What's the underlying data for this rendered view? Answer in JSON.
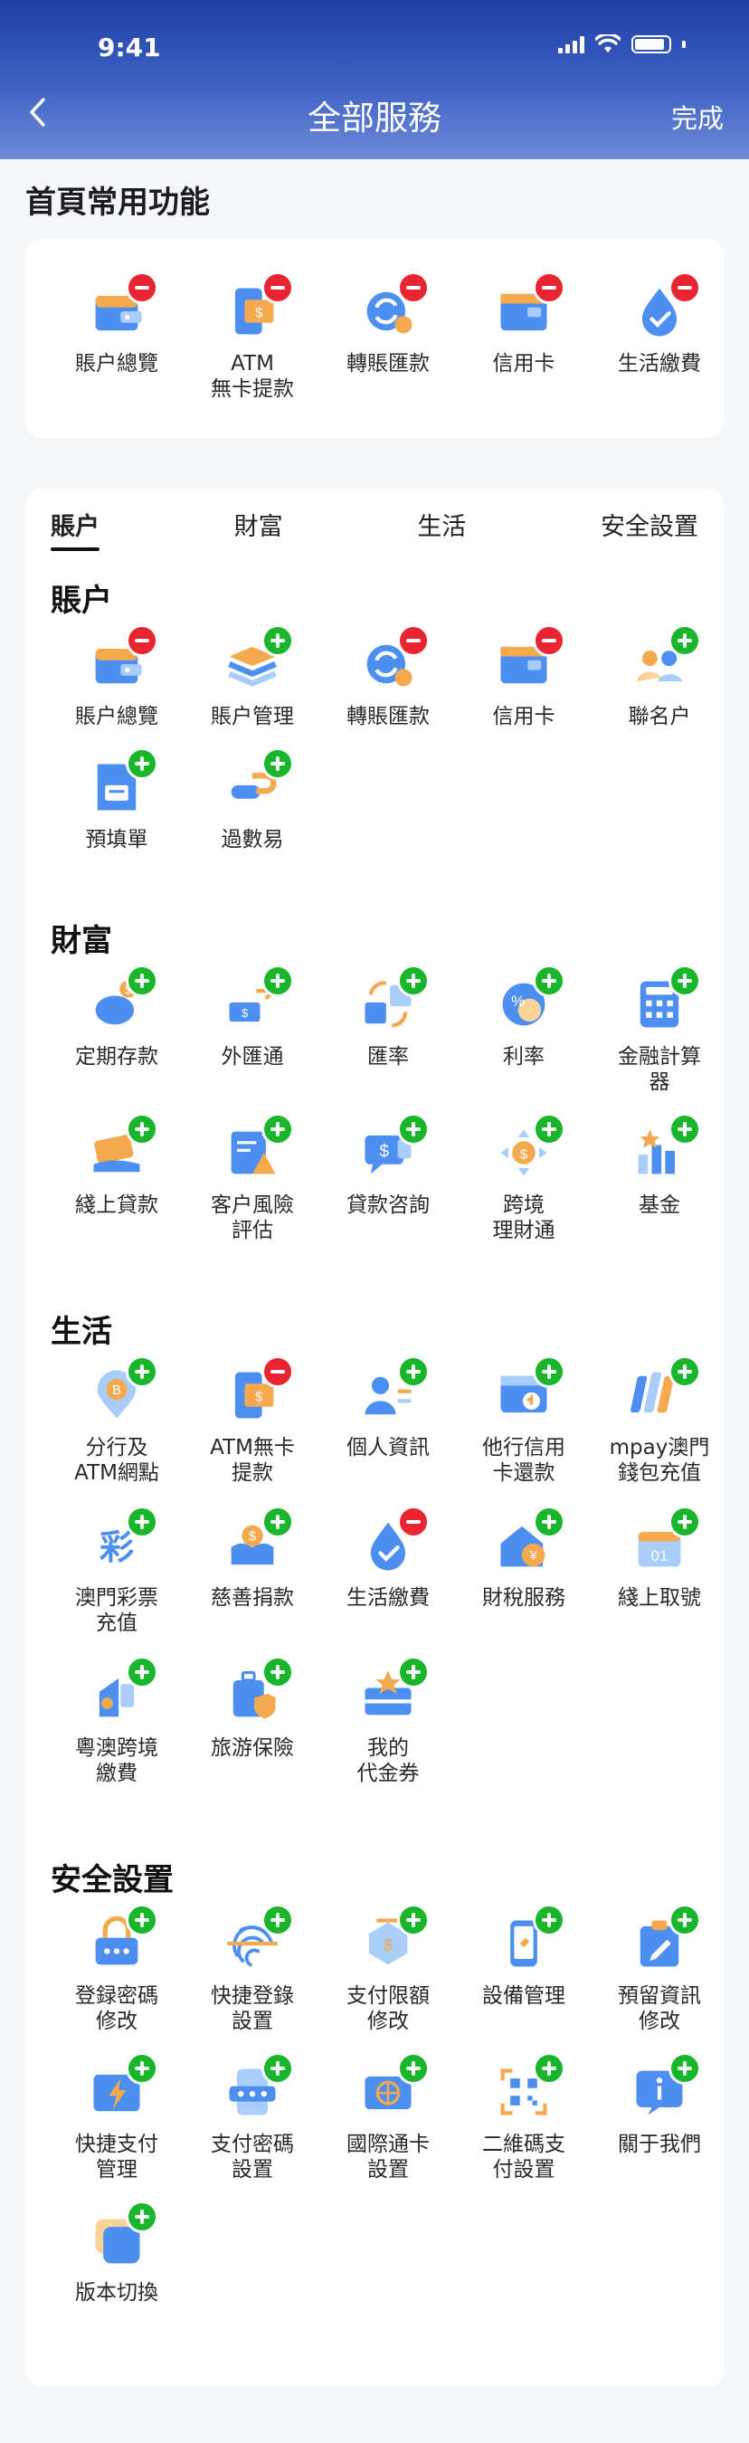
{
  "status_bar": {
    "time": "9:41"
  },
  "nav": {
    "title": "全部服務",
    "done_label": "完成"
  },
  "favorites": {
    "title": "首頁常用功能",
    "items": [
      {
        "label": "賬户總覽",
        "icon": "wallet-icon",
        "badge": "minus"
      },
      {
        "label": "ATM\n無卡提款",
        "icon": "atm-phone-icon",
        "badge": "minus"
      },
      {
        "label": "轉賬匯款",
        "icon": "transfer-icon",
        "badge": "minus"
      },
      {
        "label": "信用卡",
        "icon": "credit-card-icon",
        "badge": "minus"
      },
      {
        "label": "生活繳費",
        "icon": "water-drop-icon",
        "badge": "minus"
      }
    ]
  },
  "tabs": [
    {
      "label": "賬户",
      "active": true
    },
    {
      "label": "財富",
      "active": false
    },
    {
      "label": "生活",
      "active": false
    },
    {
      "label": "安全設置",
      "active": false
    }
  ],
  "sections": [
    {
      "title": "賬户",
      "items": [
        {
          "label": "賬户總覽",
          "icon": "wallet-icon",
          "badge": "minus"
        },
        {
          "label": "賬户管理",
          "icon": "layers-icon",
          "badge": "plus"
        },
        {
          "label": "轉賬匯款",
          "icon": "transfer-icon",
          "badge": "minus"
        },
        {
          "label": "信用卡",
          "icon": "credit-card-icon",
          "badge": "minus"
        },
        {
          "label": "聯名户",
          "icon": "joint-users-icon",
          "badge": "plus"
        },
        {
          "label": "預填單",
          "icon": "form-icon",
          "badge": "plus"
        },
        {
          "label": "過數易",
          "icon": "easy-transfer-icon",
          "badge": "plus"
        }
      ]
    },
    {
      "title": "財富",
      "items": [
        {
          "label": "定期存款",
          "icon": "piggy-bank-icon",
          "badge": "plus"
        },
        {
          "label": "外匯通",
          "icon": "forex-icon",
          "badge": "plus"
        },
        {
          "label": "匯率",
          "icon": "exchange-rate-icon",
          "badge": "plus"
        },
        {
          "label": "利率",
          "icon": "interest-rate-icon",
          "badge": "plus"
        },
        {
          "label": "金融計算\n器",
          "icon": "calculator-icon",
          "badge": "plus"
        },
        {
          "label": "綫上貸款",
          "icon": "online-loan-icon",
          "badge": "plus"
        },
        {
          "label": "客户風險\n評估",
          "icon": "risk-assessment-icon",
          "badge": "plus"
        },
        {
          "label": "貸款咨詢",
          "icon": "loan-consult-icon",
          "badge": "plus"
        },
        {
          "label": "跨境\n理財通",
          "icon": "cross-border-wealth-icon",
          "badge": "plus"
        },
        {
          "label": "基金",
          "icon": "fund-chart-icon",
          "badge": "plus"
        }
      ]
    },
    {
      "title": "生活",
      "items": [
        {
          "label": "分行及\nATM網點",
          "icon": "branch-location-icon",
          "badge": "plus"
        },
        {
          "label": "ATM無卡\n提款",
          "icon": "atm-phone-icon",
          "badge": "minus"
        },
        {
          "label": "個人資訊",
          "icon": "personal-info-icon",
          "badge": "plus"
        },
        {
          "label": "他行信用\n卡還款",
          "icon": "card-repay-icon",
          "badge": "plus"
        },
        {
          "label": "mpay澳門\n錢包充值",
          "icon": "mpay-icon",
          "badge": "plus"
        },
        {
          "label": "澳門彩票\n充值",
          "icon": "lottery-icon",
          "badge": "plus"
        },
        {
          "label": "慈善捐款",
          "icon": "charity-icon",
          "badge": "plus"
        },
        {
          "label": "生活繳費",
          "icon": "water-drop-icon",
          "badge": "minus"
        },
        {
          "label": "財稅服務",
          "icon": "tax-icon",
          "badge": "plus"
        },
        {
          "label": "綫上取號",
          "icon": "queue-ticket-icon",
          "badge": "plus"
        },
        {
          "label": "粵澳跨境\n繳費",
          "icon": "cross-border-pay-icon",
          "badge": "plus"
        },
        {
          "label": "旅游保險",
          "icon": "travel-insurance-icon",
          "badge": "plus"
        },
        {
          "label": "我的\n代金券",
          "icon": "voucher-icon",
          "badge": "plus"
        }
      ]
    },
    {
      "title": "安全設置",
      "items": [
        {
          "label": "登録密碼\n修改",
          "icon": "login-password-icon",
          "badge": "plus"
        },
        {
          "label": "快捷登錄\n設置",
          "icon": "fingerprint-icon",
          "badge": "plus"
        },
        {
          "label": "支付限額\n修改",
          "icon": "payment-limit-icon",
          "badge": "plus"
        },
        {
          "label": "設備管理",
          "icon": "device-icon",
          "badge": "plus"
        },
        {
          "label": "預留資訊\n修改",
          "icon": "clipboard-edit-icon",
          "badge": "plus"
        },
        {
          "label": "快捷支付\n管理",
          "icon": "quick-pay-icon",
          "badge": "plus"
        },
        {
          "label": "支付密碼\n設置",
          "icon": "pay-password-icon",
          "badge": "plus"
        },
        {
          "label": "國際通卡\n設置",
          "icon": "global-card-icon",
          "badge": "plus"
        },
        {
          "label": "二維碼支\n付設置",
          "icon": "qr-code-icon",
          "badge": "plus"
        },
        {
          "label": "關于我們",
          "icon": "info-icon",
          "badge": "plus"
        },
        {
          "label": "版本切換",
          "icon": "version-switch-icon",
          "badge": "plus"
        }
      ]
    }
  ]
}
